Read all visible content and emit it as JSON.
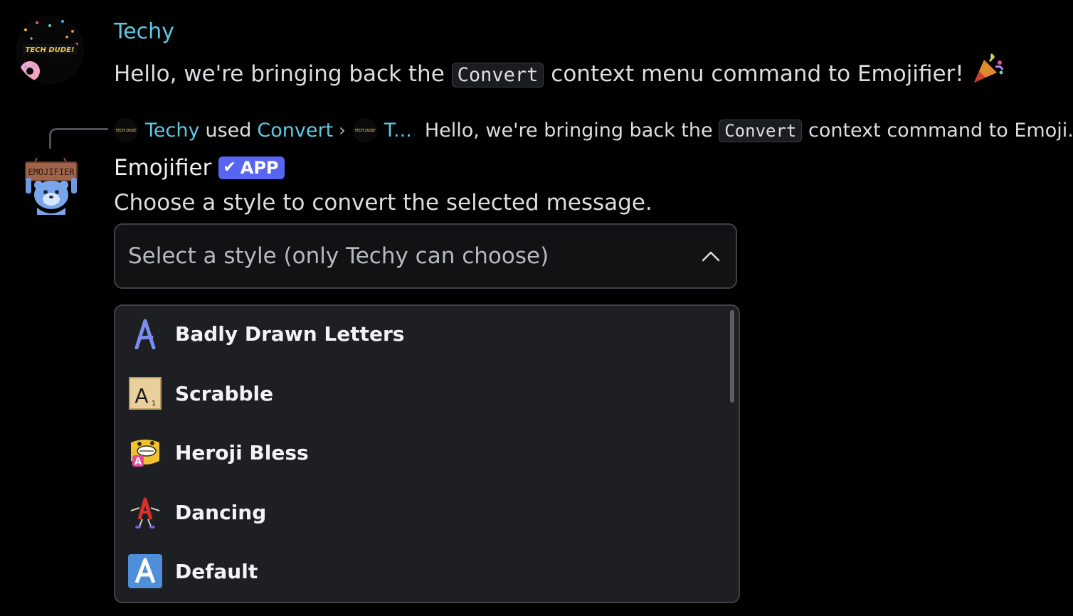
{
  "message1": {
    "author": "Techy",
    "text_before": "Hello, we're bringing back the",
    "code": "Convert",
    "text_after": "context menu command to Emojifier!",
    "emoji_icon": "party-popper-icon"
  },
  "reply": {
    "author": "Techy",
    "used": "used",
    "command": "Convert",
    "target_author": "T...",
    "preview_before": "Hello, we're bringing back the",
    "preview_code": "Convert",
    "preview_after": "context command to Emoji..."
  },
  "bot": {
    "name": "Emojifier",
    "tag": "APP",
    "text": "Choose a style to convert the selected message."
  },
  "select": {
    "placeholder": "Select a style (only Techy can choose)"
  },
  "options": [
    {
      "label": "Badly Drawn Letters",
      "icon": "badly-drawn-a-icon"
    },
    {
      "label": "Scrabble",
      "icon": "scrabble-tile-icon"
    },
    {
      "label": "Heroji Bless",
      "icon": "heroji-face-icon"
    },
    {
      "label": "Dancing",
      "icon": "dancing-letter-icon"
    },
    {
      "label": "Default",
      "icon": "regional-a-icon"
    }
  ],
  "colors": {
    "background": "#000000",
    "author": "#5fc9e3",
    "app_tag": "#5865f2",
    "dropdown_bg": "#1e1f22",
    "border": "#3f4147"
  }
}
